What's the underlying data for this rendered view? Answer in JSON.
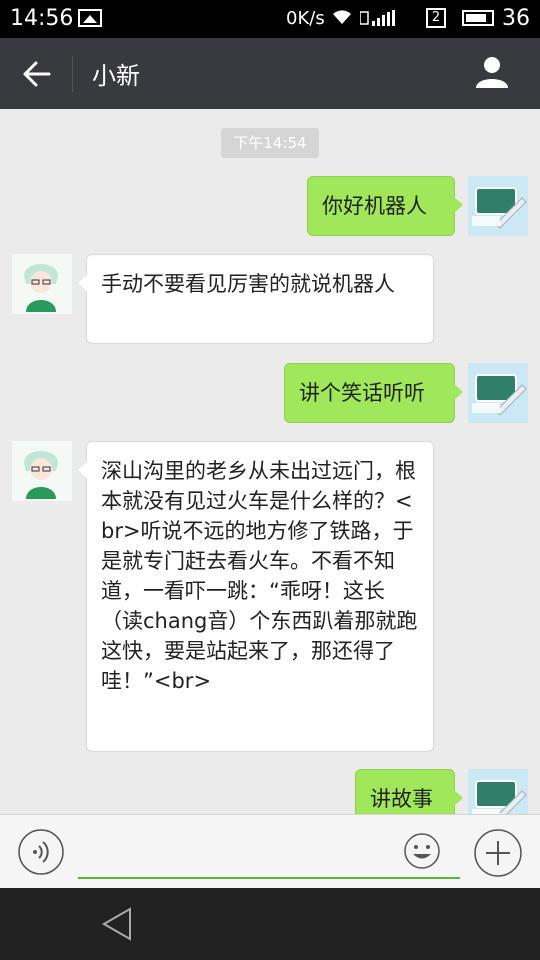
{
  "status_bar": {
    "time": "14:56",
    "speed": "0K/s",
    "sim_slot": "2",
    "battery": "36"
  },
  "header": {
    "title": "小新"
  },
  "chat": {
    "timestamp": "下午14:54",
    "messages": [
      {
        "side": "out",
        "text": "你好机器人"
      },
      {
        "side": "in",
        "text": "手动不要看见厉害的就说机器人"
      },
      {
        "side": "out",
        "text": "讲个笑话听听"
      },
      {
        "side": "in",
        "text": "深山沟里的老乡从未出过远门，根本就没有见过火车是什么样的？<br>听说不远的地方修了铁路，于是就专门赶去看火车。不看不知道，一看吓一跳：“乖呀！这长（读chang音）个东西趴着那就跑这快，要是站起来了，那还得了哇！”<br>"
      },
      {
        "side": "out",
        "text": "讲故事"
      }
    ]
  },
  "input": {
    "value": "",
    "placeholder": ""
  },
  "icons": {
    "back": "arrow-left-icon",
    "profile": "person-icon",
    "voice": "voice-icon",
    "emoji": "smiley-icon",
    "more": "plus-icon",
    "nav_back": "triangle-back-icon"
  },
  "colors": {
    "out_bubble": "#a0e75a",
    "in_bubble": "#ffffff",
    "header_bg": "#393a3f",
    "chat_bg": "#ebebeb"
  }
}
